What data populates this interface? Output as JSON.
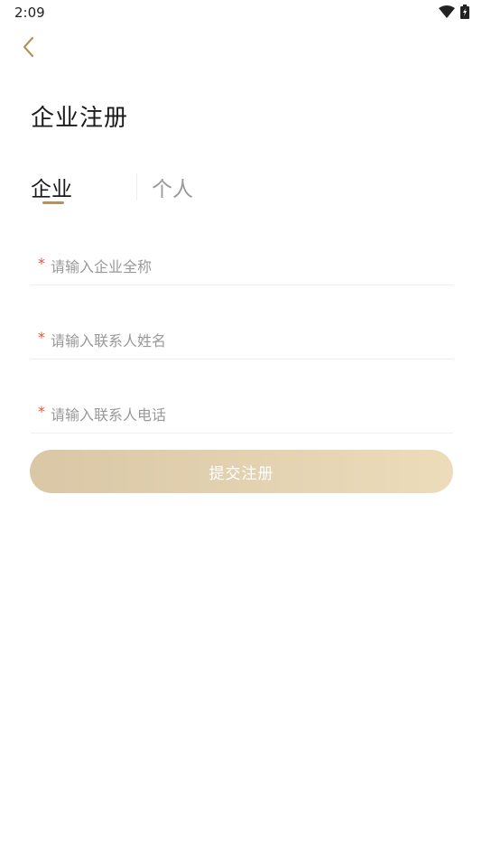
{
  "status_bar": {
    "time": "2:09",
    "icons": [
      "wifi-icon",
      "battery-charging-icon"
    ]
  },
  "header": {
    "back_icon": "chevron-left-icon",
    "title": "企业注册"
  },
  "tabs": [
    {
      "label": "企业",
      "active": true
    },
    {
      "label": "个人",
      "active": false
    }
  ],
  "form": {
    "required_mark": "*",
    "fields": [
      {
        "name": "company-name",
        "value": "",
        "placeholder": "请输入企业全称"
      },
      {
        "name": "contact-name",
        "value": "",
        "placeholder": "请输入联系人姓名"
      },
      {
        "name": "contact-phone",
        "value": "",
        "placeholder": "请输入联系人电话"
      }
    ],
    "submit_label": "提交注册"
  },
  "colors": {
    "accent": "#b8915a",
    "required": "#e0543c",
    "button_gradient_start": "#d9c7a6",
    "button_gradient_end": "#ecdcba"
  }
}
